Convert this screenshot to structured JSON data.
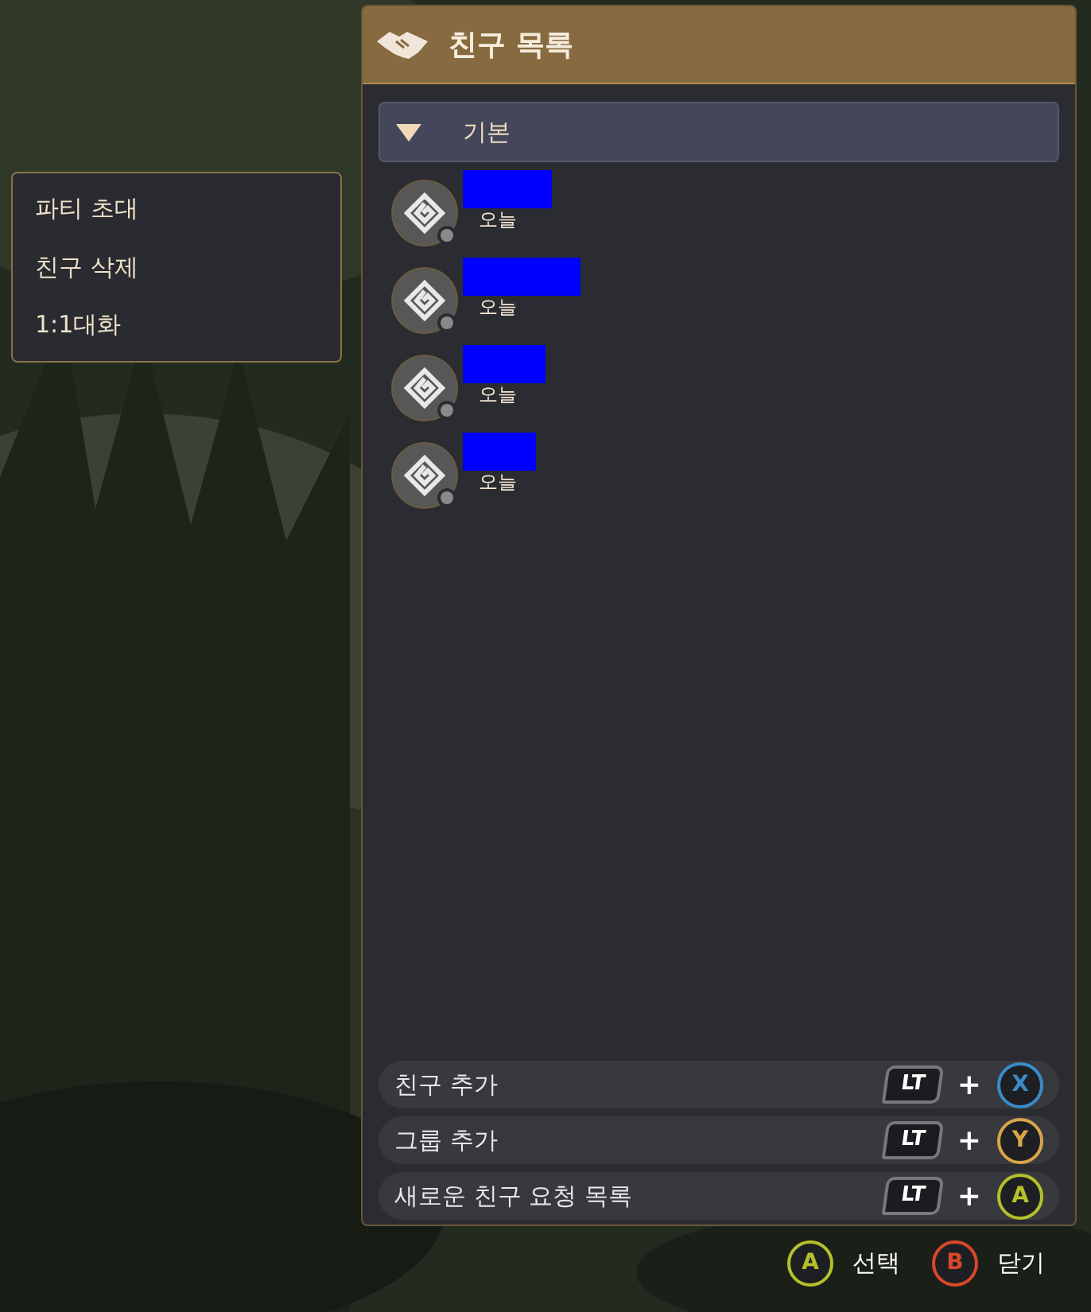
{
  "context_menu": {
    "items": [
      {
        "label": "파티 초대"
      },
      {
        "label": "친구 삭제"
      },
      {
        "label": "1:1대화"
      }
    ]
  },
  "panel": {
    "title": "친구 목록",
    "group": {
      "label": "기본",
      "expanded": true
    },
    "friends": [
      {
        "last_seen": "오늘"
      },
      {
        "last_seen": "오늘"
      },
      {
        "last_seen": "오늘"
      },
      {
        "last_seen": "오늘"
      }
    ],
    "actions": [
      {
        "label": "친구 추가",
        "modifier": "LT",
        "joiner": "+",
        "button": "X",
        "color": "#3a8cc8"
      },
      {
        "label": "그룹 추가",
        "modifier": "LT",
        "joiner": "+",
        "button": "Y",
        "color": "#d9a54a"
      },
      {
        "label": "새로운 친구 요청 목록",
        "modifier": "LT",
        "joiner": "+",
        "button": "A",
        "color": "#b5c02a"
      }
    ]
  },
  "hints": [
    {
      "button": "A",
      "label": "선택",
      "color": "#b5c02a"
    },
    {
      "button": "B",
      "label": "닫기",
      "color": "#d9472a"
    }
  ]
}
